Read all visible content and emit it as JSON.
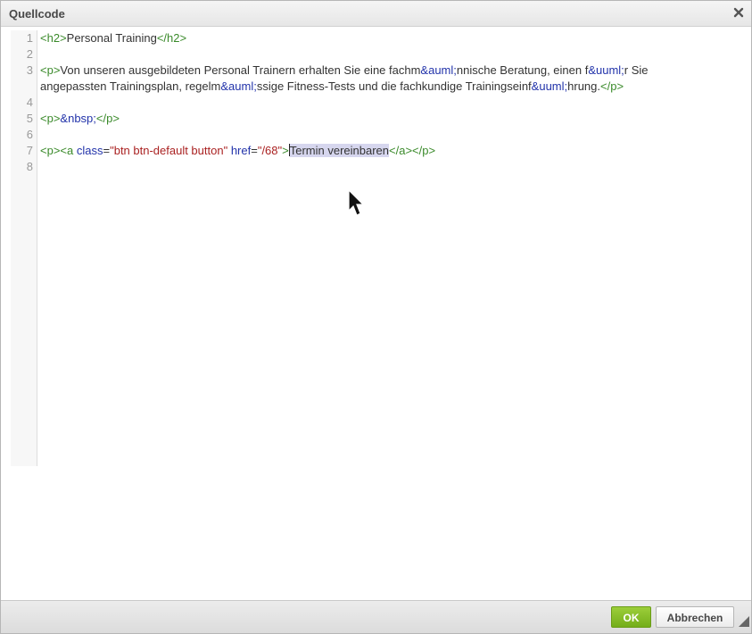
{
  "dialog": {
    "title": "Quellcode",
    "close_icon": "close-icon",
    "ok_label": "OK",
    "cancel_label": "Abbrechen"
  },
  "editor": {
    "line_numbers": [
      "1",
      "2",
      "3",
      "4",
      "5",
      "6",
      "7",
      "8"
    ],
    "line1": {
      "open": "<h2>",
      "text": "Personal Training",
      "close": "</h2>"
    },
    "line3": {
      "open": "<p>",
      "t1": "Von unseren ausgebildeten Personal Trainern erhalten Sie eine fachm",
      "e1": "&auml;",
      "t2": "nnische Beratung, einen f",
      "e2": "&uuml;",
      "t3": "r Sie angepassten Trainingsplan, regelm",
      "e3": "&auml;",
      "t4": "ssige Fitness-Tests und die fachkundige Trainingseinf",
      "e4": "&uuml;",
      "t5": "hrung.",
      "close": "</p>"
    },
    "line5": {
      "open": "<p>",
      "entity": "&nbsp;",
      "close": "</p>"
    },
    "line7": {
      "p_open": "<p>",
      "a_start": "<a",
      "attr1": "class",
      "eq1": "=",
      "val1": "\"btn btn-default button\"",
      "attr2": "href",
      "eq2": "=",
      "val2": "\"/68\"",
      "a_end": ">",
      "link_text": "Termin vereinbaren",
      "a_close": "</a>",
      "p_close": "</p>"
    }
  },
  "colors": {
    "tag": "#3a8a2a",
    "attribute": "#2233aa",
    "string": "#aa2222",
    "selection": "#d6d6ee",
    "ok_button": "#86be28"
  }
}
